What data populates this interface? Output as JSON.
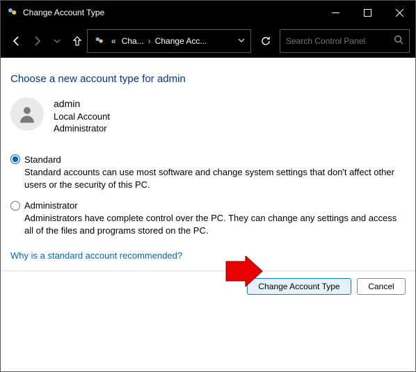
{
  "window": {
    "title": "Change Account Type"
  },
  "nav": {
    "breadcrumb_pre": "«",
    "breadcrumb_part1": "Cha...",
    "breadcrumb_part2": "Change Acc...",
    "search_placeholder": "Search Control Panel"
  },
  "main": {
    "heading": "Choose a new account type for admin",
    "user": {
      "name": "admin",
      "type": "Local Account",
      "role": "Administrator"
    },
    "options": {
      "standard": {
        "label": "Standard",
        "desc": "Standard accounts can use most software and change system settings that don't affect other users or the security of this PC."
      },
      "admin": {
        "label": "Administrator",
        "desc": "Administrators have complete control over the PC. They can change any settings and access all of the files and programs stored on the PC."
      }
    },
    "helplink": "Why is a standard account recommended?"
  },
  "buttons": {
    "change": "Change Account Type",
    "cancel": "Cancel"
  }
}
